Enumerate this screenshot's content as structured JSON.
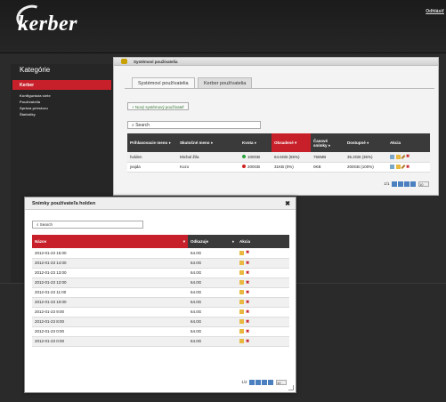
{
  "header": {
    "logo": "kerber",
    "logout": "Odhlásiť"
  },
  "sidebar": {
    "title": "Kategórie",
    "active": "Kerber",
    "items": [
      "Konfigurácia siete",
      "Používatelia",
      "Správa priestoru",
      "Štatistiky"
    ]
  },
  "main": {
    "title": "Systémoví používatelia",
    "tabs": [
      "Systémoví používatelia",
      "Kerber používatelia"
    ],
    "new_button": "+ Nový systémový používateľ",
    "search_placeholder": "Search",
    "columns": [
      "Prihlasovacie meno",
      "Skutočné meno",
      "Kvota",
      "Obsadené",
      "Časové snímky",
      "Dostupné",
      "Akcia"
    ],
    "rows": [
      {
        "login": "holden",
        "name": "Michal Žila",
        "quota": "100GB",
        "quota_color": "#2aa33a",
        "used": "64.6GB (65%)",
        "snapshots": "755MB",
        "avail": "35.2GB (35%)"
      },
      {
        "login": "jvajda",
        "name": "Kozo",
        "quota": "200GB",
        "quota_color": "#d12020",
        "used": "31KB (0%)",
        "snapshots": "0KB",
        "avail": "200GB (100%)"
      }
    ],
    "pager": {
      "page": "1/1",
      "per_page": "10"
    }
  },
  "dialog": {
    "title": "Snímky používateľa holden",
    "search_placeholder": "Search",
    "columns": [
      "Názov",
      "Odkazuje",
      "Akcia"
    ],
    "rows": [
      {
        "name": "2012-01-23 15:00",
        "ref": "64.0G"
      },
      {
        "name": "2012-01-23 14:00",
        "ref": "64.0G"
      },
      {
        "name": "2012-01-23 13:00",
        "ref": "64.0G"
      },
      {
        "name": "2012-01-23 12:00",
        "ref": "64.0G"
      },
      {
        "name": "2012-01-23 11:00",
        "ref": "64.0G"
      },
      {
        "name": "2012-01-23 10:00",
        "ref": "64.0G"
      },
      {
        "name": "2012-01-23 9:00",
        "ref": "64.0G"
      },
      {
        "name": "2012-01-23 8:00",
        "ref": "64.0G"
      },
      {
        "name": "2012-01-23 0:00",
        "ref": "64.0G"
      },
      {
        "name": "2012-01-23 0:00",
        "ref": "64.0G"
      }
    ],
    "pager": {
      "page": "1/2",
      "per_page": "10"
    }
  }
}
